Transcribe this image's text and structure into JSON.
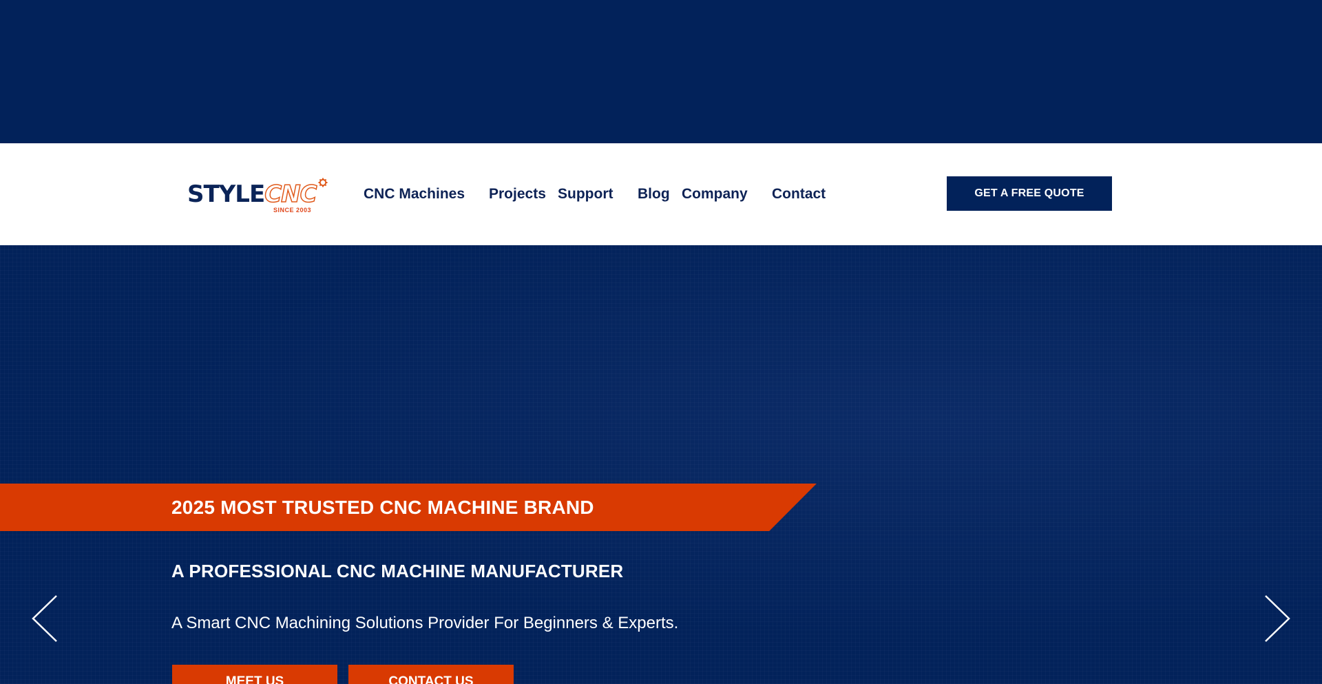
{
  "brand": {
    "logo_style": "STYLE",
    "logo_cnc": "CNC",
    "logo_since": "SINCE 2003",
    "gear_icon": "gear-icon"
  },
  "nav": {
    "items": [
      "CNC Machines",
      "Projects",
      "Support",
      "Blog",
      "Company",
      "Contact"
    ]
  },
  "header": {
    "quote_button": "GET A FREE QUOTE"
  },
  "hero": {
    "banner": "2025 MOST TRUSTED CNC MACHINE BRAND",
    "title": "A PROFESSIONAL CNC MACHINE MANUFACTURER",
    "subtitle": "A Smart CNC Machining Solutions Provider For Beginners & Experts.",
    "buttons": {
      "meet": "MEET US",
      "contact": "CONTACT US"
    },
    "prev_icon": "chevron-left-icon",
    "next_icon": "chevron-right-icon"
  },
  "colors": {
    "navy": "#02225a",
    "orange": "#d93a02",
    "white": "#ffffff"
  }
}
